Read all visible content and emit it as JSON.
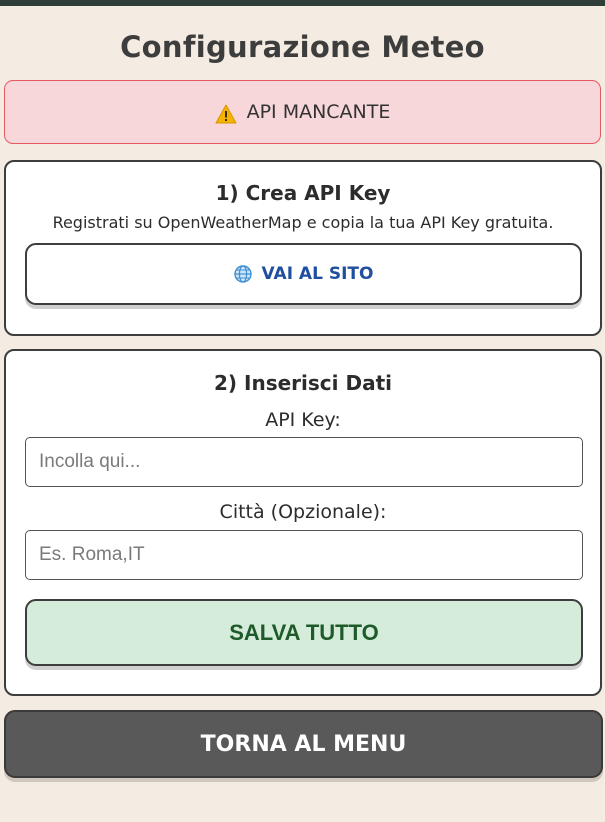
{
  "page": {
    "title": "Configurazione Meteo"
  },
  "alert": {
    "icon": "warning-icon",
    "text": "API MANCANTE",
    "colors": {
      "background": "#f7d7da",
      "border": "#e35a63"
    }
  },
  "step1": {
    "title": "1) Crea API Key",
    "description": "Registrati su OpenWeatherMap e copia la tua API Key gratuita.",
    "button": {
      "icon": "globe-icon",
      "label": "VAI AL SITO"
    }
  },
  "step2": {
    "title": "2) Inserisci Dati",
    "api_key": {
      "label": "API Key:",
      "value": "",
      "placeholder": "Incolla qui..."
    },
    "city": {
      "label": "Città (Opzionale):",
      "value": "",
      "placeholder": "Es. Roma,IT"
    },
    "save_button": {
      "label": "SALVA TUTTO",
      "color": "#d5ecdb"
    }
  },
  "footer": {
    "back_button": {
      "label": "TORNA AL MENU",
      "color": "#595959"
    }
  }
}
